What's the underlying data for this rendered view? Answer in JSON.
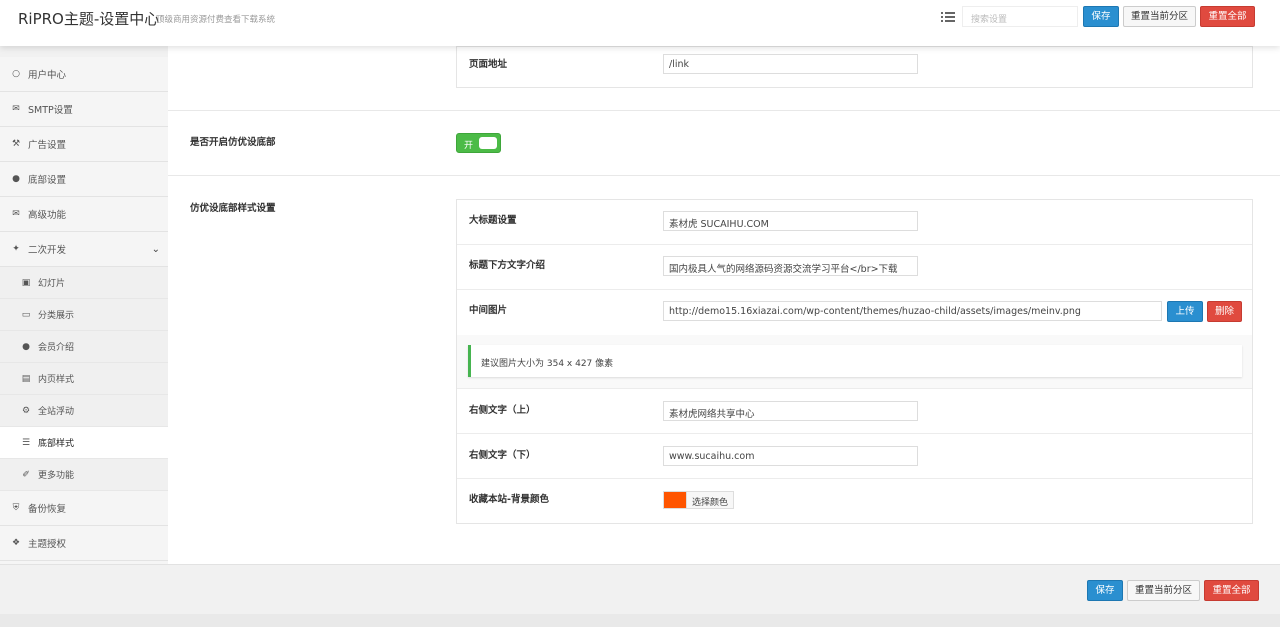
{
  "header": {
    "title": "RiPRO主题-设置中心",
    "tagline": "顶级商用资源付费查看下载系统",
    "search_placeholder": "搜索设置",
    "save_label": "保存",
    "reset_section_label": "重置当前分区",
    "reset_all_label": "重置全部"
  },
  "sidebar": {
    "items": [
      {
        "label": "用户中心",
        "icon": "user-icon"
      },
      {
        "label": "SMTP设置",
        "icon": "envelope-icon"
      },
      {
        "label": "广告设置",
        "icon": "gavel-icon"
      },
      {
        "label": "底部设置",
        "icon": "circle-icon"
      },
      {
        "label": "高级功能",
        "icon": "envelope-icon"
      },
      {
        "label": "二次开发",
        "icon": "magic-wand-icon"
      }
    ],
    "sub_items": [
      {
        "label": "幻灯片",
        "icon": "film-icon"
      },
      {
        "label": "分类展示",
        "icon": "bookmark-icon"
      },
      {
        "label": "会员介绍",
        "icon": "user-icon"
      },
      {
        "label": "内页样式",
        "icon": "document-icon"
      },
      {
        "label": "全站浮动",
        "icon": "gear-icon"
      },
      {
        "label": "底部样式",
        "icon": "sliders-icon"
      },
      {
        "label": "更多功能",
        "icon": "brush-icon"
      }
    ],
    "bottom_items": [
      {
        "label": "备份恢复",
        "icon": "shield-icon"
      },
      {
        "label": "主题授权",
        "icon": "handshake-icon"
      }
    ]
  },
  "main": {
    "page_url_label": "页面地址",
    "page_url_value": "/link",
    "enable_label": "是否开启仿优设底部",
    "toggle_label": "开",
    "style_section_label": "仿优设底部样式设置",
    "fields": {
      "big_title_label": "大标题设置",
      "big_title_value": "素材虎 SUCAIHU.COM",
      "subtitle_label": "标题下方文字介绍",
      "subtitle_value": "国内极具人气的网络源码资源交流学习平台</br>下载",
      "middle_image_label": "中间图片",
      "middle_image_value": "http://demo15.16xiazai.com/wp-content/themes/huzao-child/assets/images/meinv.png",
      "upload_label": "上传",
      "delete_label": "删除",
      "notice": "建议图片大小为 354 x 427 像素",
      "right_text_top_label": "右侧文字（上）",
      "right_text_top_value": "素材虎网络共享中心",
      "right_text_bottom_label": "右侧文字（下）",
      "right_text_bottom_value": "www.sucaihu.com",
      "bookmark_bg_label": "收藏本站-背景颜色",
      "bookmark_bg_color": "#ff5500",
      "choose_color_label": "选择颜色"
    }
  },
  "footer": {
    "save_label": "保存",
    "reset_section_label": "重置当前分区",
    "reset_all_label": "重置全部"
  }
}
